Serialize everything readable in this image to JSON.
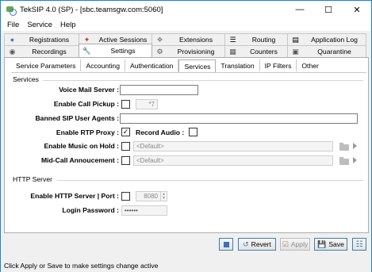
{
  "window": {
    "title": "TekSIP 4.0 (SP) - [sbc.teamsgw.com:5060]"
  },
  "menu": {
    "items": [
      "File",
      "Service",
      "Help"
    ]
  },
  "tabs_top": [
    {
      "label": "Registrations",
      "icon": "users-icon"
    },
    {
      "label": "Active Sessions",
      "icon": "sessions-icon"
    },
    {
      "label": "Extensions",
      "icon": "puzzle-icon"
    },
    {
      "label": "Routing",
      "icon": "routing-list-icon"
    },
    {
      "label": "Application Log",
      "icon": "log-icon"
    }
  ],
  "tabs_bottom": [
    {
      "label": "Recordings",
      "icon": "recordings-icon"
    },
    {
      "label": "Settings",
      "icon": "wrench-icon",
      "active": true
    },
    {
      "label": "Provisioning",
      "icon": "provisioning-icon"
    },
    {
      "label": "Counters",
      "icon": "counters-icon"
    },
    {
      "label": "Quarantine",
      "icon": "quarantine-icon"
    }
  ],
  "subtabs": [
    "Service Parameters",
    "Accounting",
    "Authentication",
    "Services",
    "Translation",
    "IP Filters",
    "Other"
  ],
  "services": {
    "group_title": "Services",
    "voice_mail_server": {
      "label": "Voice Mail Server :",
      "value": ""
    },
    "call_pickup": {
      "label": "Enable Call Pickup :",
      "checked": false,
      "value": "*7"
    },
    "banned_agents": {
      "label": "Banned SIP User Agents :",
      "value": ""
    },
    "rtp_proxy": {
      "label": "Enable RTP Proxy :",
      "checked": true
    },
    "record_audio": {
      "label": "Record Audio :",
      "checked": false
    },
    "music_on_hold": {
      "label": "Enable Music on Hold :",
      "checked": false,
      "value": "<Default>"
    },
    "mid_call": {
      "label": "Mid-Call Annoucement :",
      "checked": false,
      "value": "<Default>"
    }
  },
  "http": {
    "group_title": "HTTP Server",
    "enable": {
      "label": "Enable HTTP Server | Port :",
      "checked": false,
      "port": "8080"
    },
    "password": {
      "label": "Login Password :",
      "value": "••••••"
    }
  },
  "buttons": {
    "revert": "Revert",
    "apply": "Apply",
    "save": "Save"
  },
  "status": {
    "text": "Click Apply or Save to make settings change active"
  },
  "colors": {
    "accent": "#1883d7",
    "button_border": "#3c7fb1"
  }
}
